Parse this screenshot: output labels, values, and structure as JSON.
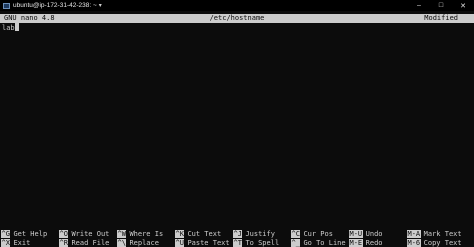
{
  "window": {
    "title": "ubuntu@ip-172-31-42-238: ~",
    "arrow": "▾",
    "controls": {
      "minimize": "–",
      "maximize": "□",
      "close": "✕"
    }
  },
  "nano": {
    "version": "GNU nano 4.8",
    "filename": "/etc/hostname",
    "status": "Modified"
  },
  "buffer": {
    "lines": [
      "lab"
    ]
  },
  "shortcuts": [
    [
      {
        "key": "^G",
        "label": "Get Help"
      },
      {
        "key": "^X",
        "label": "Exit"
      }
    ],
    [
      {
        "key": "^O",
        "label": "Write Out"
      },
      {
        "key": "^R",
        "label": "Read File"
      }
    ],
    [
      {
        "key": "^W",
        "label": "Where Is"
      },
      {
        "key": "^\\",
        "label": "Replace"
      }
    ],
    [
      {
        "key": "^K",
        "label": "Cut Text"
      },
      {
        "key": "^U",
        "label": "Paste Text"
      }
    ],
    [
      {
        "key": "^J",
        "label": "Justify"
      },
      {
        "key": "^T",
        "label": "To Spell"
      }
    ],
    [
      {
        "key": "^C",
        "label": "Cur Pos"
      },
      {
        "key": "^_",
        "label": "Go To Line"
      }
    ],
    [
      {
        "key": "M-U",
        "label": "Undo"
      },
      {
        "key": "M-E",
        "label": "Redo"
      }
    ],
    [
      {
        "key": "M-A",
        "label": "Mark Text"
      },
      {
        "key": "M-6",
        "label": "Copy Text"
      }
    ]
  ],
  "colors": {
    "background": "#0c0c0c",
    "foreground": "#cccccc",
    "titlebar": "#000000"
  }
}
